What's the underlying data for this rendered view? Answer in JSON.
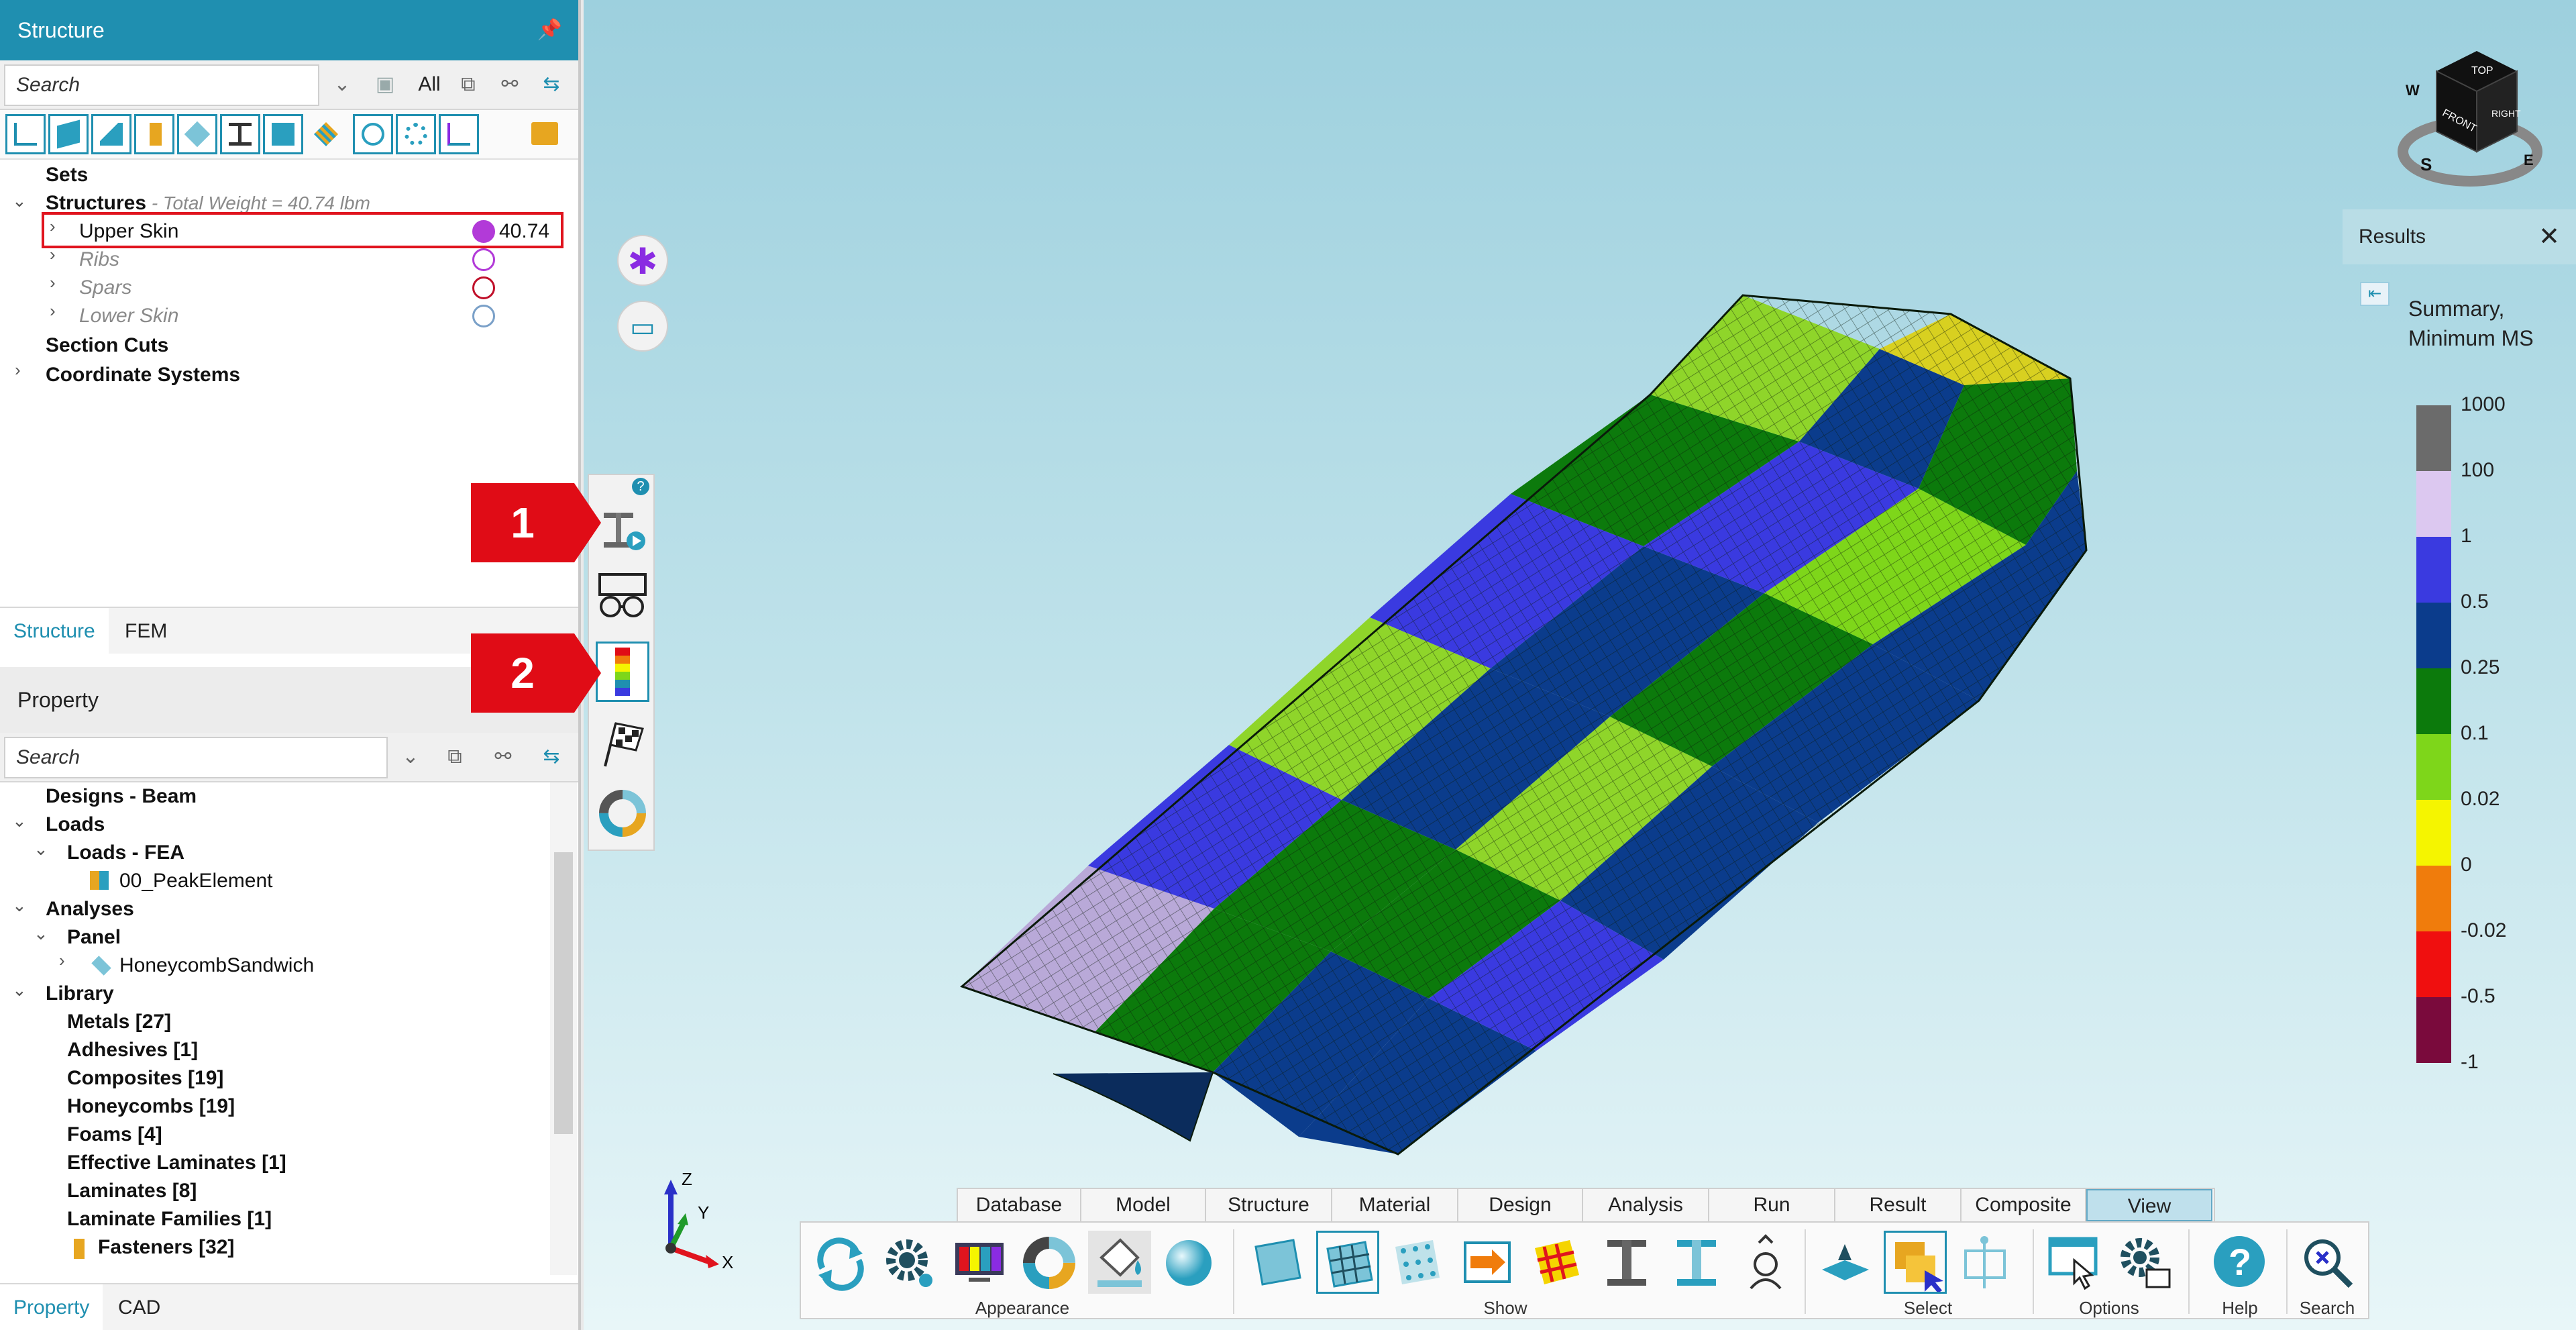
{
  "structure_panel": {
    "title": "Structure",
    "search_placeholder": "Search",
    "filter_all": "All",
    "tree": {
      "sets": "Sets",
      "structures": "Structures",
      "structures_note": " - Total Weight = 40.74 lbm",
      "upper_skin": "Upper Skin",
      "upper_skin_value": "40.74",
      "ribs": "Ribs",
      "spars": "Spars",
      "lower_skin": "Lower Skin",
      "section_cuts": "Section Cuts",
      "coordinate_systems": "Coordinate Systems"
    },
    "tabs": [
      "Structure",
      "FEM"
    ]
  },
  "property_panel": {
    "title": "Property",
    "search_placeholder": "Search",
    "tree": {
      "designs_beam": "Designs - Beam",
      "loads": "Loads",
      "loads_fea": "Loads - FEA",
      "peak_element": "00_PeakElement",
      "analyses": "Analyses",
      "panel": "Panel",
      "honeycomb_sandwich": "HoneycombSandwich",
      "library": "Library",
      "metals": "Metals [27]",
      "adhesives": "Adhesives [1]",
      "composites": "Composites [19]",
      "honeycombs": "Honeycombs [19]",
      "foams": "Foams [4]",
      "effective_laminates": "Effective Laminates [1]",
      "laminates": "Laminates [8]",
      "laminate_families": "Laminate Families [1]",
      "fasteners": "Fasteners [32]"
    },
    "tabs": [
      "Property",
      "CAD"
    ]
  },
  "callouts": [
    "1",
    "2"
  ],
  "nav_cube": {
    "top": "TOP",
    "front": "FRONT",
    "right": "RIGHT",
    "compass_w": "W",
    "compass_s": "S",
    "compass_e": "E"
  },
  "results_panel": {
    "title": "Results",
    "close": "✕",
    "legend_title": "Summary, Minimum MS",
    "legend": [
      {
        "label": "1000",
        "color": "#6b6b6b"
      },
      {
        "label": "100",
        "color": "#dcc8f0"
      },
      {
        "label": "1",
        "color": "#3a3ae0"
      },
      {
        "label": "0.5",
        "color": "#0b3c8c"
      },
      {
        "label": "0.25",
        "color": "#0c7a0c"
      },
      {
        "label": "0.1",
        "color": "#7ed61a"
      },
      {
        "label": "0.02",
        "color": "#f5f500"
      },
      {
        "label": "0",
        "color": "#f07c0c"
      },
      {
        "label": "-0.02",
        "color": "#f00f0f"
      },
      {
        "label": "-0.5",
        "color": "#7a0a3c"
      },
      {
        "label": "-1",
        "color": ""
      }
    ]
  },
  "triad": {
    "z": "Z",
    "y": "Y",
    "x": "X"
  },
  "ribbon": {
    "tabs": [
      "Database",
      "Model",
      "Structure",
      "Material",
      "Design",
      "Analysis",
      "Run",
      "Result",
      "Composite",
      "View"
    ],
    "active_tab": "View",
    "groups": [
      "Appearance",
      "Show",
      "Select",
      "Options",
      "Help",
      "Search"
    ]
  },
  "colors": {
    "accent": "#1f8fb0",
    "callout_red": "#e00c16",
    "upper_skin_dot": "#b23ad8"
  }
}
